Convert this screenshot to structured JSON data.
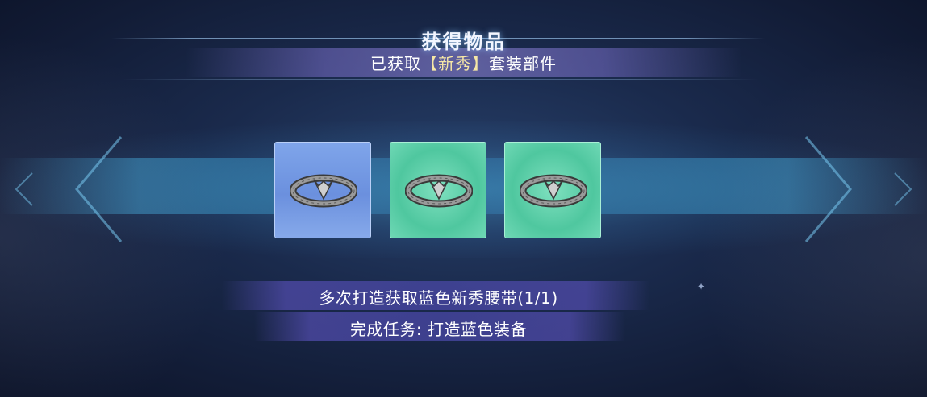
{
  "dialog": {
    "title": "获得物品",
    "subtitle_prefix": "已获取",
    "subtitle_highlight": "【新秀】",
    "subtitle_suffix": "套装部件"
  },
  "items": [
    {
      "rarity": "blue",
      "color": "#7fa5ea",
      "icon": "belt-icon"
    },
    {
      "rarity": "green",
      "color": "#5fd0a8",
      "icon": "belt-icon"
    },
    {
      "rarity": "green",
      "color": "#5fd0a8",
      "icon": "belt-icon"
    }
  ],
  "tasks": [
    {
      "text": "多次打造获取蓝色新秀腰带(1/1)"
    },
    {
      "text": "完成任务: 打造蓝色装备"
    }
  ]
}
